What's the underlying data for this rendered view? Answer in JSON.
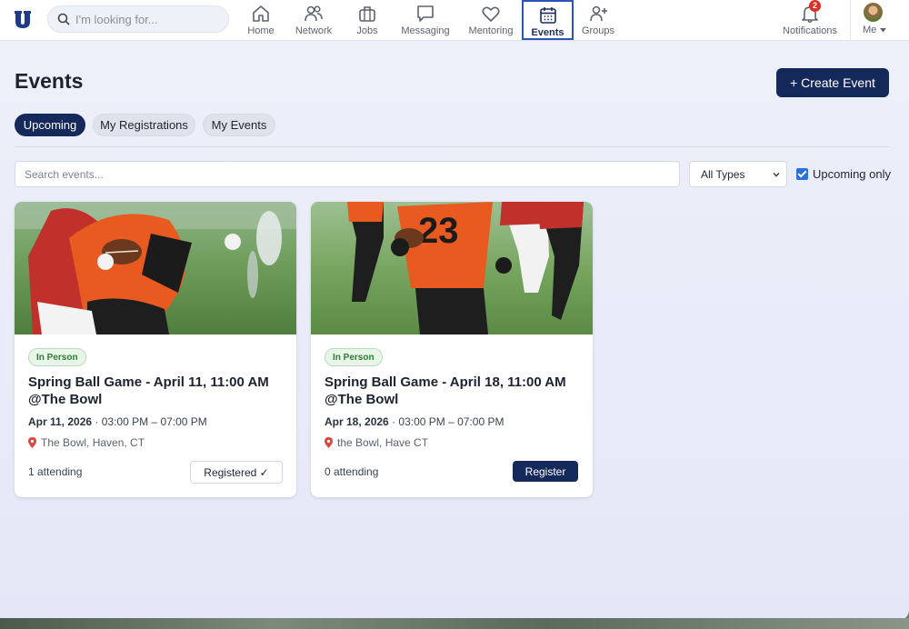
{
  "nav": {
    "search_placeholder": "I'm looking for...",
    "items": [
      {
        "label": "Home",
        "icon": "home-icon"
      },
      {
        "label": "Network",
        "icon": "people-icon"
      },
      {
        "label": "Jobs",
        "icon": "briefcase-icon"
      },
      {
        "label": "Messaging",
        "icon": "chat-icon"
      },
      {
        "label": "Mentoring",
        "icon": "heart-icon"
      },
      {
        "label": "Events",
        "icon": "calendar-icon",
        "active": true
      },
      {
        "label": "Groups",
        "icon": "add-user-icon"
      }
    ],
    "notifications": {
      "label": "Notifications",
      "count": "2"
    },
    "me": {
      "label": "Me"
    }
  },
  "page": {
    "title": "Events",
    "create_button": "+ Create Event",
    "tabs": [
      {
        "label": "Upcoming",
        "active": true
      },
      {
        "label": "My Registrations"
      },
      {
        "label": "My Events"
      }
    ],
    "search_placeholder": "Search events...",
    "type_filter": "All Types",
    "upcoming_only": "Upcoming only"
  },
  "events": [
    {
      "tag": "In Person",
      "title": "Spring Ball Game - April 11, 11:00 AM @The Bowl",
      "date": "Apr 11, 2026",
      "time": "· 03:00 PM – 07:00 PM",
      "location": "The Bowl, Haven, CT",
      "attending": "1 attending",
      "action": "Registered ✓"
    },
    {
      "tag": "In Person",
      "title": "Spring Ball Game - April 18, 11:00 AM @The Bowl",
      "date": "Apr 18, 2026",
      "time": "· 03:00 PM – 07:00 PM",
      "location": "the Bowl, Have CT",
      "attending": "0 attending",
      "action": "Register"
    }
  ],
  "colors": {
    "brand_navy": "#14295a",
    "active_outline": "#2c55b8",
    "tag_green": "#2e7d32",
    "badge_red": "#d93025"
  }
}
